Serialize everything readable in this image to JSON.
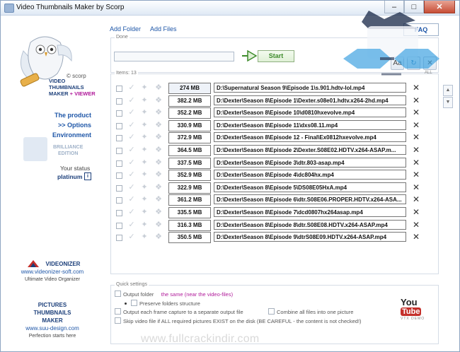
{
  "window": {
    "title": "Video Thumbnails Maker by Scorp",
    "minimize": "–",
    "maximize": "□",
    "close": "✕"
  },
  "sidebar": {
    "scorp": "© scorp",
    "product_line1": "VIDEO",
    "product_line2": "THUMBNAILS",
    "product_line3": "MAKER",
    "product_plus": "+",
    "product_viewer": "VIEWER",
    "menu": [
      "The product",
      ">> Options",
      "Environment"
    ],
    "brilliance": [
      "BRILLIANCE",
      "EDITION"
    ],
    "status_label": "Your status",
    "status_value": "platinum",
    "status_info": "i",
    "promos": [
      {
        "name": "VIDEONIZER",
        "url": "www.videonizer-soft.com",
        "desc": "Ultimate Video Organizer"
      },
      {
        "name": "PICTURES THUMBNAILS MAKER",
        "url": "www.suu-design.com",
        "desc": "Perfection starts here"
      }
    ]
  },
  "toolbar": {
    "add_folder": "Add Folder",
    "add_files": "Add Files",
    "faq": "FAQ"
  },
  "done": {
    "label": "Done",
    "start": "Start",
    "progress": 0
  },
  "items": {
    "label": "Items: 13",
    "delete_all": "ALL",
    "rows": [
      {
        "size": "274 MB",
        "path": "D:\\Supernatural Season 9\\Episode 1\\s.901.hdtv-lol.mp4"
      },
      {
        "size": "382.2 MB",
        "path": "D:\\Dexter\\Season 8\\Episode 1\\Dexter.s08e01.hdtv.x264-2hd.mp4"
      },
      {
        "size": "352.2 MB",
        "path": "D:\\Dexter\\Season 8\\Episode 10\\d0810hxevolve.mp4"
      },
      {
        "size": "330.9 MB",
        "path": "D:\\Dexter\\Season 8\\Episode 11\\dxs08.11.mp4"
      },
      {
        "size": "372.9 MB",
        "path": "D:\\Dexter\\Season 8\\Episode 12 - Final\\Ex0812hxevolve.mp4"
      },
      {
        "size": "364.5 MB",
        "path": "D:\\Dexter\\Season 8\\Episode 2\\Dexter.S08E02.HDTV.x264-ASAP.m..."
      },
      {
        "size": "337.5 MB",
        "path": "D:\\Dexter\\Season 8\\Episode 3\\dtr.803-asap.mp4"
      },
      {
        "size": "352.9 MB",
        "path": "D:\\Dexter\\Season 8\\Episode 4\\dc804hx.mp4"
      },
      {
        "size": "322.9 MB",
        "path": "D:\\Dexter\\Season 8\\Episode 5\\DS08E05HxA.mp4"
      },
      {
        "size": "361.2 MB",
        "path": "D:\\Dexter\\Season 8\\Episode 6\\dtr.S08E06.PROPER.HDTV.x264-ASA..."
      },
      {
        "size": "335.5 MB",
        "path": "D:\\Dexter\\Season 8\\Episode 7\\dcd0807hx264asap.mp4"
      },
      {
        "size": "316.3 MB",
        "path": "D:\\Dexter\\Season 8\\Episode 8\\dtr.S08E08.HDTV.x264-ASAP.mp4"
      },
      {
        "size": "350.5 MB",
        "path": "D:\\Dexter\\Season 8\\Episode 9\\dtrS08E09.HDTV.x264-ASAP.mp4"
      }
    ]
  },
  "quick_settings": {
    "label": "Quick settings",
    "output_folder": "Output  folder",
    "output_value": "the same (near the video-files)",
    "preserve": "Preserve folders structure",
    "each_frame": "Output each frame capture to a separate output file",
    "combine": "Combine all files into one picture",
    "skip": "Skip video file if ALL required pictures EXIST on the disk (BE CAREFUL - the content is not checked!)"
  },
  "youtube": {
    "you": "You",
    "tube": "Tube",
    "sub": "VTX DEMO"
  },
  "watermark": "www.fullcrackindir.com"
}
